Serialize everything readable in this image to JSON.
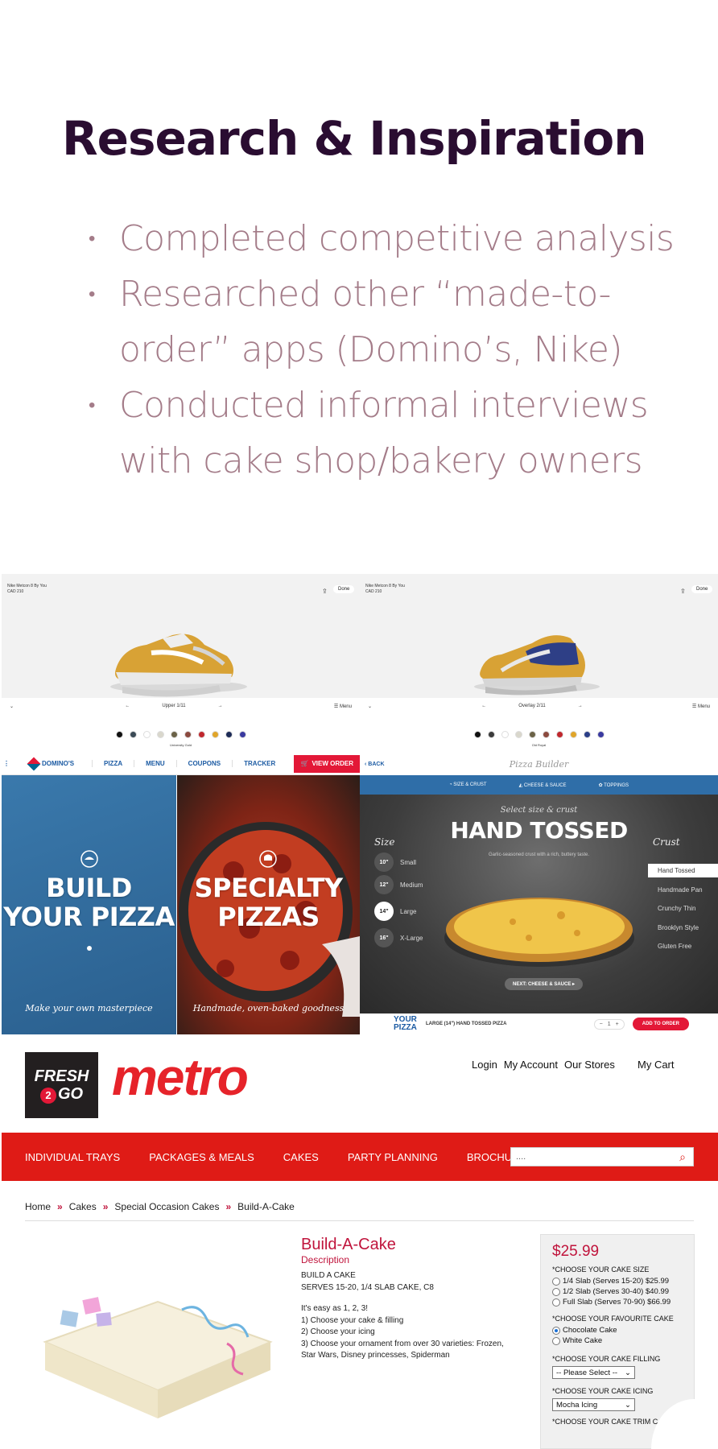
{
  "slide": {
    "title": "Research & Inspiration",
    "bullets": [
      "Completed competitive analysis",
      "Researched other “made-to-order” apps (Domino’s, Nike)",
      "Conducted informal interviews with cake shop/bakery owners"
    ]
  },
  "nike": {
    "left": {
      "product_name": "Nike Metcon 8 By You",
      "price": "CAD 210",
      "done_label": "Done",
      "section_label": "Upper",
      "step": "1/11",
      "menu_label": "Menu",
      "caption": "University Gold",
      "swatch_colors": [
        "#111111",
        "#3b4a56",
        "#ffffff",
        "#d9d7cc",
        "#6b6247",
        "#8b4a3f",
        "#c0272d",
        "#e0a52a",
        "#1d2b57",
        "#3a3aa0"
      ]
    },
    "right": {
      "product_name": "Nike Metcon 8 By You",
      "price": "CAD 210",
      "done_label": "Done",
      "section_label": "Overlay",
      "step": "2/11",
      "menu_label": "Menu",
      "caption": "Old Royal",
      "swatch_colors": [
        "#111111",
        "#3b3b3b",
        "#ffffff",
        "#d9d7cc",
        "#6b6247",
        "#8b4a3f",
        "#c0272d",
        "#e0a52a",
        "#2b3e87",
        "#3a3aa0"
      ]
    }
  },
  "dominos": {
    "nav": {
      "brand": "DOMINO'S",
      "items": [
        "PIZZA",
        "MENU",
        "COUPONS",
        "TRACKER"
      ],
      "view_order": "VIEW ORDER"
    },
    "panels": [
      {
        "title_line1": "BUILD",
        "title_line2": "YOUR PIZZA",
        "subtitle": "Make your own masterpiece"
      },
      {
        "title_line1": "SPECIALTY",
        "title_line2": "PIZZAS",
        "subtitle": "Handmade, oven-baked goodness"
      }
    ],
    "builder": {
      "back_label": "BACK",
      "header_title": "Pizza Builder",
      "tabs": [
        "SIZE & CRUST",
        "CHEESE & SAUCE",
        "TOPPINGS"
      ],
      "select_prompt": "Select size & crust",
      "crust_title": "HAND TOSSED",
      "crust_desc": "Garlic-seasoned crust with a rich, buttery taste.",
      "size_heading": "Size",
      "crust_heading": "Crust",
      "sizes": [
        {
          "inch": "10\"",
          "label": "Small"
        },
        {
          "inch": "12\"",
          "label": "Medium"
        },
        {
          "inch": "14\"",
          "label": "Large"
        },
        {
          "inch": "16\"",
          "label": "X-Large"
        }
      ],
      "selected_size": "14\"",
      "crusts": [
        "Hand Tossed",
        "Handmade Pan",
        "Crunchy Thin",
        "Brooklyn Style",
        "Gluten Free"
      ],
      "selected_crust": "Hand Tossed",
      "next_label": "NEXT: CHEESE & SAUCE",
      "your_label_1": "YOUR",
      "your_label_2": "PIZZA",
      "order_summary": "LARGE (14\") HAND TOSSED PIZZA",
      "qty": "1",
      "add_label": "ADD TO ORDER"
    }
  },
  "metro": {
    "fresh_line1": "FRESH",
    "fresh_two": "2",
    "fresh_line2": "GO",
    "wordmark": "metro",
    "top_links": [
      "Login",
      "My Account",
      "Our Stores"
    ],
    "cart": "My Cart",
    "nav": [
      "INDIVIDUAL TRAYS",
      "PACKAGES & MEALS",
      "CAKES",
      "PARTY PLANNING",
      "BROCHURE"
    ],
    "search_value": "....",
    "breadcrumb": [
      "Home",
      "Cakes",
      "Special Occasion Cakes",
      "Build-A-Cake"
    ],
    "breadcrumb_sep": "»",
    "product_title": "Build-A-Cake",
    "description_heading": "Description",
    "desc_line1": "BUILD A CAKE",
    "desc_line2": "SERVES 15-20, 1/4 SLAB CAKE, C8",
    "desc_steps": [
      "It's easy as 1, 2, 3!",
      "1) Choose your cake & filling",
      "2) Choose your icing",
      "3) Choose your ornament from over 30 varieties: Frozen, Star Wars, Disney princesses, Spiderman"
    ],
    "price": "$25.99",
    "size_heading": "*CHOOSE YOUR CAKE SIZE",
    "sizes": [
      "1/4 Slab (Serves 15-20) $25.99",
      "1/2 Slab (Serves 30-40) $40.99",
      "Full Slab (Serves 70-90) $66.99"
    ],
    "flavour_heading": "*CHOOSE YOUR FAVOURITE CAKE",
    "flavours": [
      "Chocolate Cake",
      "White Cake"
    ],
    "selected_flavour": "Chocolate Cake",
    "filling_heading": "*CHOOSE YOUR CAKE FILLING",
    "filling_value": "-- Please Select --",
    "icing_heading": "*CHOOSE YOUR CAKE ICING",
    "icing_value": "Mocha Icing",
    "trim_heading": "*CHOOSE YOUR CAKE TRIM C"
  }
}
